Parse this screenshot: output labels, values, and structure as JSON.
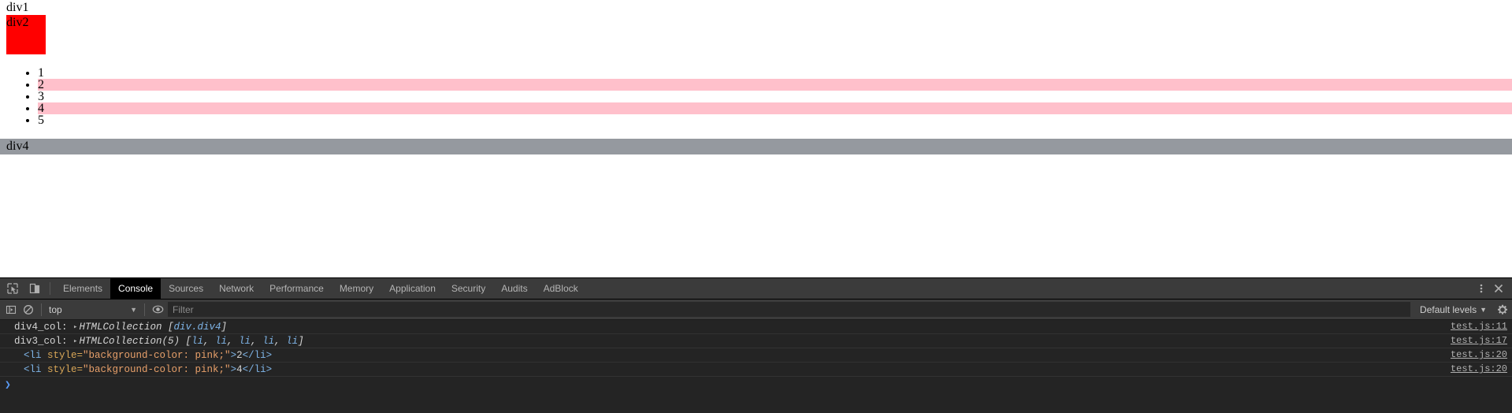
{
  "page": {
    "div1_label": "div1",
    "div2_label": "div2",
    "div2_color": "#ff0000",
    "list_items": [
      {
        "text": "1",
        "highlighted": false
      },
      {
        "text": "2",
        "highlighted": true
      },
      {
        "text": "3",
        "highlighted": false
      },
      {
        "text": "4",
        "highlighted": true
      },
      {
        "text": "5",
        "highlighted": false
      }
    ],
    "highlight_color": "#ffc0cb",
    "div4_label": "div4",
    "div4_color": "#95999f"
  },
  "devtools": {
    "icons": {
      "inspect": "inspect-element-icon",
      "device": "device-toolbar-icon",
      "more": "more-options-icon",
      "close": "close-icon",
      "sidebar": "console-sidebar-icon",
      "clear": "clear-console-icon",
      "eye": "live-expression-icon",
      "gear": "settings-gear-icon"
    },
    "tabs": [
      {
        "label": "Elements",
        "active": false
      },
      {
        "label": "Console",
        "active": true
      },
      {
        "label": "Sources",
        "active": false
      },
      {
        "label": "Network",
        "active": false
      },
      {
        "label": "Performance",
        "active": false
      },
      {
        "label": "Memory",
        "active": false
      },
      {
        "label": "Application",
        "active": false
      },
      {
        "label": "Security",
        "active": false
      },
      {
        "label": "Audits",
        "active": false
      },
      {
        "label": "AdBlock",
        "active": false
      }
    ],
    "filterbar": {
      "context": "top",
      "context_caret": "▼",
      "filter_placeholder": "Filter",
      "filter_value": "",
      "levels_label": "Default levels",
      "levels_caret": "▼"
    },
    "console": {
      "messages": [
        {
          "type": "object",
          "indent": false,
          "prefix": "div4_col: ",
          "triangle": "▸",
          "body_italic": "HTMLCollection ",
          "body_bracket_open": "[",
          "nodes": [
            "div.div4"
          ],
          "body_bracket_close": "]",
          "source": "test.js:11"
        },
        {
          "type": "object",
          "indent": false,
          "prefix": "div3_col: ",
          "triangle": "▸",
          "body_italic": "HTMLCollection(5) ",
          "body_bracket_open": "[",
          "nodes": [
            "li",
            "li",
            "li",
            "li",
            "li"
          ],
          "body_bracket_close": "]",
          "source": "test.js:17"
        },
        {
          "type": "html",
          "indent": true,
          "tag_open": "<li ",
          "attr_name": "style=",
          "attr_value": "\"background-color: pink;\"",
          "gt": ">",
          "inner_text": "2",
          "tag_close": "</li>",
          "source": "test.js:20"
        },
        {
          "type": "html",
          "indent": true,
          "tag_open": "<li ",
          "attr_name": "style=",
          "attr_value": "\"background-color: pink;\"",
          "gt": ">",
          "inner_text": "4",
          "tag_close": "</li>",
          "source": "test.js:20"
        }
      ],
      "prompt_symbol": "❯"
    }
  }
}
